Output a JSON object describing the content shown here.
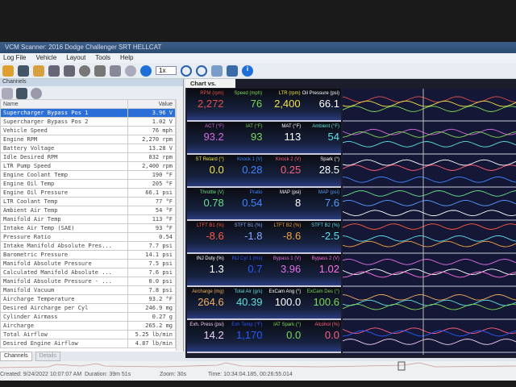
{
  "window": {
    "title": "VCM Scanner: 2016 Dodge Challenger SRT HELLCAT"
  },
  "menu": [
    "Log File",
    "Vehicle",
    "Layout",
    "Tools",
    "Help"
  ],
  "toolbar": {
    "speed": "1x"
  },
  "channels": {
    "title": "Channels",
    "col_name": "Name",
    "col_value": "Value",
    "rows": [
      {
        "name": "Supercharger Bypass Pos 1",
        "value": "3.96 V"
      },
      {
        "name": "Supercharger Bypass Pos 2",
        "value": "1.02 V"
      },
      {
        "name": "Vehicle Speed",
        "value": "76 mph"
      },
      {
        "name": "Engine RPM",
        "value": "2,270 rpm"
      },
      {
        "name": "Battery Voltage",
        "value": "13.28 V"
      },
      {
        "name": "Idle Desired RPM",
        "value": "832 rpm"
      },
      {
        "name": "LTR Pump Speed",
        "value": "2,400 rpm"
      },
      {
        "name": "Engine Coolant Temp",
        "value": "190 °F"
      },
      {
        "name": "Engine Oil Temp",
        "value": "205 °F"
      },
      {
        "name": "Engine Oil Pressure",
        "value": "66.1 psi"
      },
      {
        "name": "LTR Coolant Temp",
        "value": "77 °F"
      },
      {
        "name": "Ambient Air Temp",
        "value": "54 °F"
      },
      {
        "name": "Manifold Air Temp",
        "value": "113 °F"
      },
      {
        "name": "Intake Air Temp (SAE)",
        "value": "93 °F"
      },
      {
        "name": "Pressure Ratio",
        "value": "0.54"
      },
      {
        "name": "Intake Manifold Absolute Pres...",
        "value": "7.7 psi"
      },
      {
        "name": "Barometric Pressure",
        "value": "14.1 psi"
      },
      {
        "name": "Manifold Absolute Pressure",
        "value": "7.5 psi"
      },
      {
        "name": "Calculated Manifold Absolute ...",
        "value": "7.6 psi"
      },
      {
        "name": "Manifold Absolute Pressure - ...",
        "value": "0.0 psi"
      },
      {
        "name": "Manifold Vacuum",
        "value": "7.8 psi"
      },
      {
        "name": "Aircharge Temperature",
        "value": "93.2 °F"
      },
      {
        "name": "Desired Aircharge per Cyl",
        "value": "246.9 mg"
      },
      {
        "name": "Cylinder Airmass",
        "value": "0.27 g"
      },
      {
        "name": "Aircharge",
        "value": "265.2 mg"
      },
      {
        "name": "Total Airflow",
        "value": "5.25 lb/min"
      },
      {
        "name": "Desired Engine Airflow",
        "value": "4.87 lb/min"
      }
    ]
  },
  "bottom_tabs": [
    "Channels",
    "Details"
  ],
  "chart_tab": "Chart vs. Time",
  "gauges": [
    [
      {
        "l": "RPM (rpm)",
        "v": "2,272",
        "c": "#e0504a"
      },
      {
        "l": "Speed (mph)",
        "v": "76",
        "c": "#7ed957"
      },
      {
        "l": "LTR (rpm)",
        "v": "2,400",
        "c": "#f2e24a"
      },
      {
        "l": "Oil Pressure (psi)",
        "v": "66.1",
        "c": "#ffffff"
      }
    ],
    [
      {
        "l": "ACT (°F)",
        "v": "93.2",
        "c": "#d76ae0"
      },
      {
        "l": "IAT (°F)",
        "v": "93",
        "c": "#7ed957"
      },
      {
        "l": "MAT (°F)",
        "v": "113",
        "c": "#ffffff"
      },
      {
        "l": "Ambient (°F)",
        "v": "54",
        "c": "#5fe0e0"
      }
    ],
    [
      {
        "l": "ST Retard (°)",
        "v": "0.0",
        "c": "#f2e24a"
      },
      {
        "l": "Knock 1 (V)",
        "v": "0.28",
        "c": "#3f86ff"
      },
      {
        "l": "Knock 2 (V)",
        "v": "0.25",
        "c": "#ff5f7a"
      },
      {
        "l": "Spark (°)",
        "v": "28.5",
        "c": "#ffffff"
      }
    ],
    [
      {
        "l": "Throttle (V)",
        "v": "0.78",
        "c": "#6ee08a"
      },
      {
        "l": "Pratio",
        "v": "0.54",
        "c": "#3f86ff"
      },
      {
        "l": "MAP (psi)",
        "v": "8",
        "c": "#ffffff"
      },
      {
        "l": "MAP (psi)",
        "v": "7.6",
        "c": "#5a9cff"
      }
    ],
    [
      {
        "l": "LTFT B1 (%)",
        "v": "-8.6",
        "c": "#ff5a40"
      },
      {
        "l": "STFT B1 (%)",
        "v": "-1.8",
        "c": "#8aaaff"
      },
      {
        "l": "LTFT B2 (%)",
        "v": "-8.6",
        "c": "#f2a040"
      },
      {
        "l": "STFT B2 (%)",
        "v": "-2.5",
        "c": "#5fe0f0"
      }
    ],
    [
      {
        "l": "INJ Duty (%)",
        "v": "1.3",
        "c": "#ffffff"
      },
      {
        "l": "INJ Cyl 1 (ms)",
        "v": "0.7",
        "c": "#2a5aff"
      },
      {
        "l": "Bypass 1 (V)",
        "v": "3.96",
        "c": "#e070e8"
      },
      {
        "l": "Bypass 2 (V)",
        "v": "1.02",
        "c": "#ff70e0"
      }
    ],
    [
      {
        "l": "Aircharge (mg)",
        "v": "264.6",
        "c": "#f2b060"
      },
      {
        "l": "Total Air (g/s)",
        "v": "40.39",
        "c": "#5fe0e0"
      },
      {
        "l": "ExCam Ang (°)",
        "v": "100.0",
        "c": "#ffffff"
      },
      {
        "l": "ExCam Des (°)",
        "v": "100.6",
        "c": "#7ed957"
      }
    ],
    [
      {
        "l": "Exh. Press (psi)",
        "v": "14.2",
        "c": "#f0d0f0"
      },
      {
        "l": "Exh Temp (°F)",
        "v": "1,170",
        "c": "#2a5aff"
      },
      {
        "l": "IAT Spark (°)",
        "v": "0.0",
        "c": "#7ed957"
      },
      {
        "l": "Alcohol (%)",
        "v": "0.0",
        "c": "#ff6080"
      }
    ]
  ],
  "status": {
    "created": "Created: 9/24/2022 10:07:07 AM",
    "duration": "Duration: 39m 51s",
    "zoom": "Zoom: 30s",
    "time": "Time: 10:34:04.185, 00:26:55.014"
  }
}
